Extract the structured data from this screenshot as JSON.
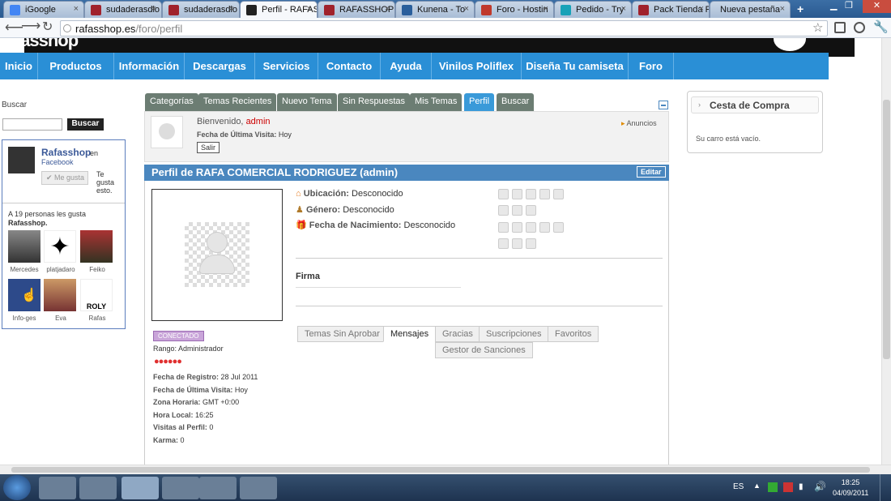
{
  "browser": {
    "tabs": [
      {
        "label": "iGoogle",
        "fav": "#4285f4"
      },
      {
        "label": "sudaderasdlo",
        "fav": "#a0222c"
      },
      {
        "label": "sudaderasdlo",
        "fav": "#a0222c"
      },
      {
        "label": "Perfil - RAFAS",
        "fav": "#222222"
      },
      {
        "label": "RAFASSHOP",
        "fav": "#a0222c"
      },
      {
        "label": "Kunena - To",
        "fav": "#2a5f9c"
      },
      {
        "label": "Foro - Hostin",
        "fav": "#c0392b"
      },
      {
        "label": "Pedido - Try",
        "fav": "#17a2b8"
      },
      {
        "label": "Pack Tienda F",
        "fav": "#a0222c"
      },
      {
        "label": "Nueva pestaña",
        "fav": ""
      }
    ],
    "active_tab": 3,
    "url_host": "rafasshop.es",
    "url_path": "/foro/perfil"
  },
  "site": {
    "logo": "rafasshop",
    "nav": [
      "Inicio",
      "Productos",
      "Información",
      "Descargas",
      "Servicios",
      "Contacto",
      "Ayuda",
      "Vinilos Poliflex",
      "Diseña Tu camiseta",
      "Foro"
    ]
  },
  "sidebar": {
    "search_label": "Buscar",
    "search_button": "Buscar",
    "fb": {
      "name": "Rafasshop",
      "en": "en",
      "facebook": "Facebook",
      "like_button": "Me gusta",
      "te_gusta": "Te gusta esto.",
      "people_text": "A 19 personas les gusta",
      "page_name": "Rafasshop.",
      "friends": [
        "Mercedes",
        "platjadaro",
        "Feiko",
        "Info-ges",
        "Eva",
        "Rafas"
      ]
    }
  },
  "forum": {
    "tabs": [
      "Categorías",
      "Temas Recientes",
      "Nuevo Tema",
      "Sin Respuestas",
      "Mis Temas",
      "Perfil",
      "Buscar"
    ],
    "active_tab": 5,
    "welcome": "Bienvenido,",
    "user": "admin",
    "last_visit_label": "Fecha de Última Visita:",
    "last_visit_value": "Hoy",
    "logout": "Salir",
    "announcements": "Anuncios",
    "profile_title": "Perfil de RAFA COMERCIAL  RODRIGUEZ (admin)",
    "edit": "Editar",
    "location_label": "Ubicación:",
    "location_value": "Desconocido",
    "gender_label": "Género:",
    "gender_value": "Desconocido",
    "birth_label": "Fecha de Nacimiento:",
    "birth_value": "Desconocido",
    "signature": "Firma",
    "status": "CONECTADO",
    "rank_label": "Rango:",
    "rank_value": "Administrador",
    "stats": [
      {
        "label": "Fecha de Registro:",
        "value": "28 Jul 2011"
      },
      {
        "label": "Fecha de Última Visita:",
        "value": "Hoy"
      },
      {
        "label": "Zona Horaria:",
        "value": "GMT +0:00"
      },
      {
        "label": "Hora Local:",
        "value": "16:25"
      },
      {
        "label": "Visitas al Perfil:",
        "value": "0"
      },
      {
        "label": "Karma:",
        "value": "0"
      }
    ],
    "profile_tabs": [
      "Temas Sin Aprobar",
      "Mensajes",
      "Gracias",
      "Suscripciones",
      "Favoritos",
      "Gestor de Sanciones"
    ],
    "active_profile_tab": 1
  },
  "cart": {
    "title": "Cesta de Compra",
    "empty": "Su carro está vacío."
  },
  "taskbar": {
    "lang": "ES",
    "time": "18:25",
    "date": "04/09/2011"
  }
}
